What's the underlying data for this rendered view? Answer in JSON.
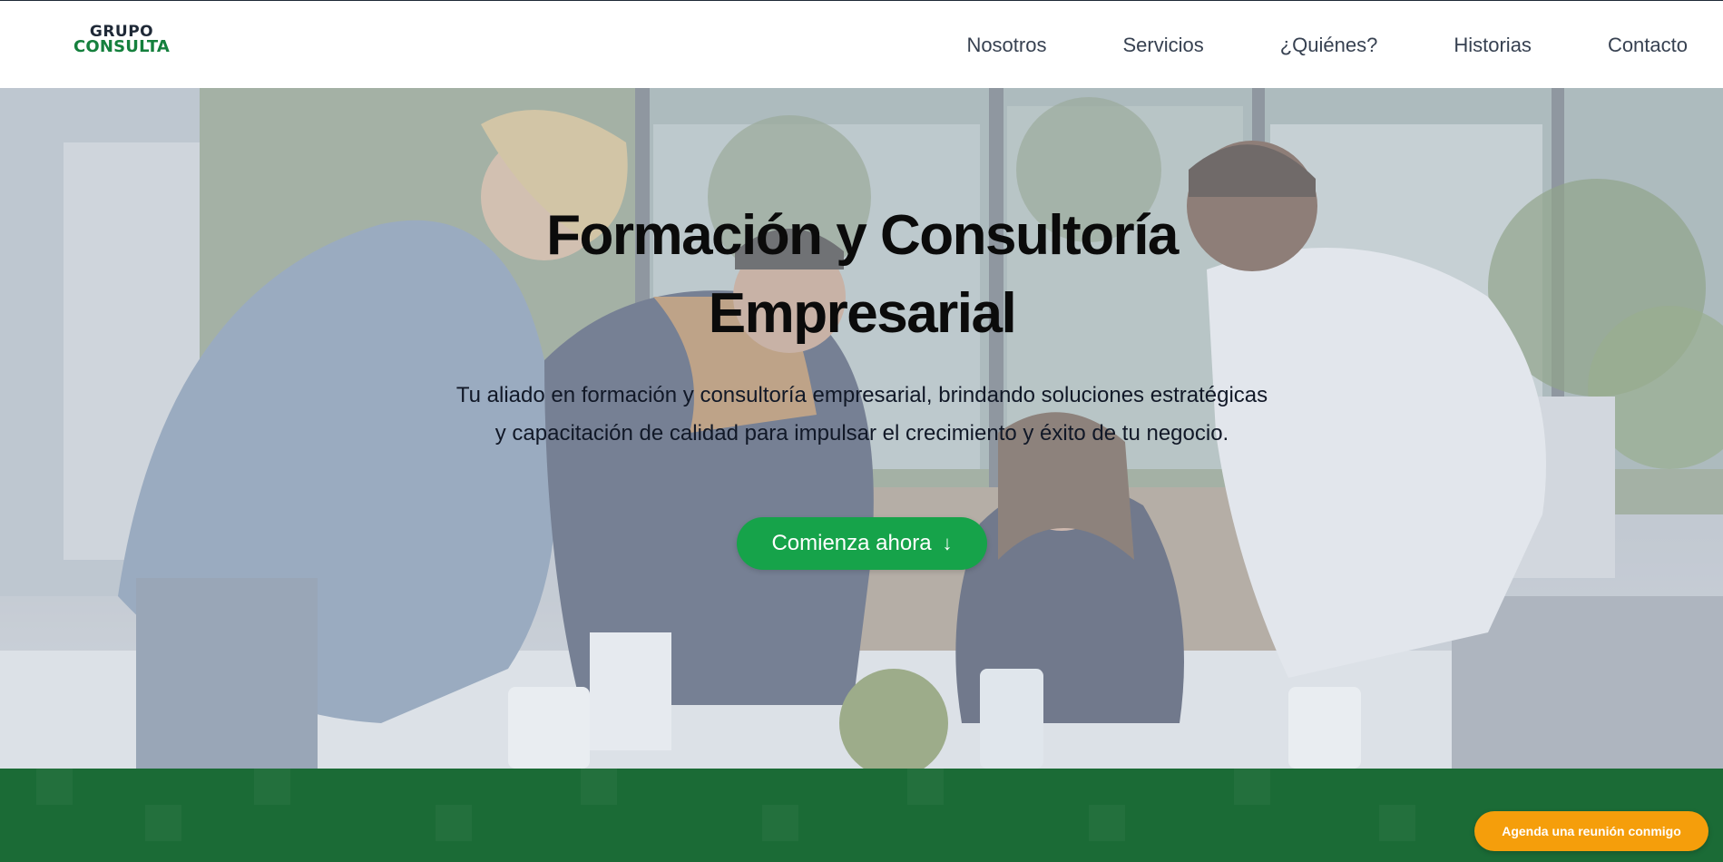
{
  "brand": {
    "line1": "GRUPO",
    "line2": "CONSULTA",
    "colors": {
      "primary": "#15803d",
      "dark": "#1f2937"
    }
  },
  "nav": {
    "items": [
      {
        "label": "Nosotros"
      },
      {
        "label": "Servicios"
      },
      {
        "label": "¿Quiénes?"
      },
      {
        "label": "Historias"
      },
      {
        "label": "Contacto"
      }
    ]
  },
  "hero": {
    "title_line1": "Formación y Consultoría",
    "title_line2": "Empresarial",
    "subtitle_line1": "Tu aliado en formación y consultoría empresarial, brindando soluciones estratégicas",
    "subtitle_line2": "y capacitación de calidad para impulsar el crecimiento y éxito de tu negocio.",
    "cta_label": "Comienza ahora",
    "cta_icon": "arrow-down-icon",
    "background": "office-team-photo",
    "colors": {
      "cta": "#16a34a"
    }
  },
  "section_band": {
    "color": "#1b6b36"
  },
  "floating": {
    "meeting_label": "Agenda una reunión conmigo",
    "color": "#f59e0b"
  }
}
